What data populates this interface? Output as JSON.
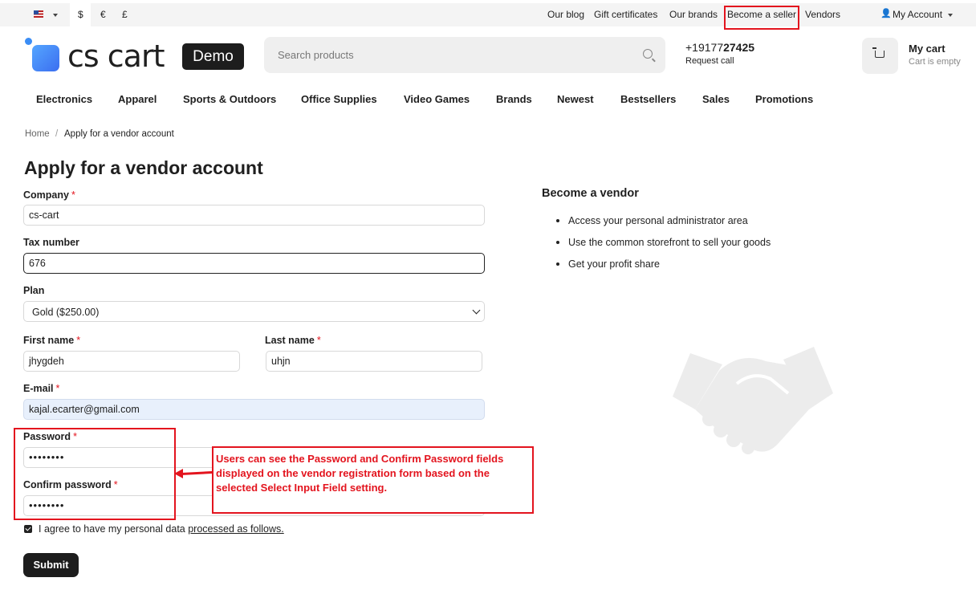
{
  "topbar": {
    "currencies": [
      "$",
      "€",
      "£"
    ],
    "links": [
      "Our blog",
      "Gift certificates",
      "Our brands",
      "Become a seller",
      "Vendors"
    ],
    "account": "My Account"
  },
  "header": {
    "logo_text": "cs cart",
    "badge": "Demo",
    "search_placeholder": "Search products",
    "phone_prefix": "+19177",
    "phone_bold": "27425",
    "request_call": "Request call",
    "cart_title": "My cart",
    "cart_status": "Cart is empty"
  },
  "nav": [
    "Electronics",
    "Apparel",
    "Sports & Outdoors",
    "Office Supplies",
    "Video Games",
    "Brands",
    "Newest",
    "Bestsellers",
    "Sales",
    "Promotions"
  ],
  "breadcrumb": {
    "home": "Home",
    "sep": "/",
    "current": "Apply for a vendor account"
  },
  "form": {
    "title": "Apply for a vendor account",
    "company_label": "Company",
    "company_value": "cs-cart",
    "tax_label": "Tax number",
    "tax_value": "676",
    "plan_label": "Plan",
    "plan_value": "Gold ($250.00)",
    "first_label": "First name",
    "first_value": "jhygdeh",
    "last_label": "Last name",
    "last_value": "uhjn",
    "email_label": "E-mail",
    "email_value": "kajal.ecarter@gmail.com",
    "password_label": "Password",
    "password_value": "••••••••",
    "confirm_label": "Confirm password",
    "confirm_value": "••••••••",
    "required_mark": "*",
    "agree_text": "I agree to have my personal data ",
    "agree_link": "processed as follows.",
    "submit": "Submit"
  },
  "vendor": {
    "title": "Become a vendor",
    "items": [
      "Access your personal administrator area",
      "Use the common storefront to sell your goods",
      "Get your profit share"
    ]
  },
  "annotation": {
    "text": "Users can see the Password and Confirm Password fields displayed on the vendor registration form based on the selected Select Input Field setting."
  },
  "colors": {
    "accent_red": "#e3141e",
    "logo_blue": "#3b8df5",
    "dark": "#1d1d1d"
  }
}
